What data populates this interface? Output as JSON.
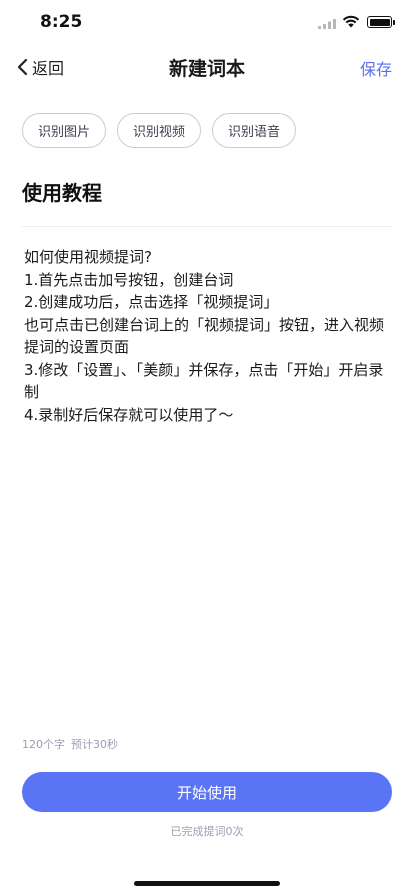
{
  "status_bar": {
    "time": "8:25",
    "icons": [
      "signal-icon",
      "wifi-icon",
      "battery-icon"
    ]
  },
  "nav": {
    "back_label": "返回",
    "title": "新建词本",
    "save_label": "保存",
    "accent_color": "#5870f0"
  },
  "chips": [
    {
      "label": "识别图片"
    },
    {
      "label": "识别视频"
    },
    {
      "label": "识别语音"
    }
  ],
  "document": {
    "title": "使用教程",
    "lines": [
      "如何使用视频提词?",
      "1.首先点击加号按钮，创建台词",
      "2.创建成功后，点击选择「视频提词」",
      "也可点击已创建台词上的「视频提词」按钮，进入视频提词的设置页面",
      "3.修改「设置」、「美颜」并保存，点击「开始」开启录制",
      "4.录制好后保存就可以使用了～"
    ]
  },
  "stats": {
    "char_count": "120个字",
    "estimate": "预计30秒"
  },
  "start_button": {
    "label": "开始使用",
    "color": "#5a74f6"
  },
  "completed_text": "已完成提词0次"
}
